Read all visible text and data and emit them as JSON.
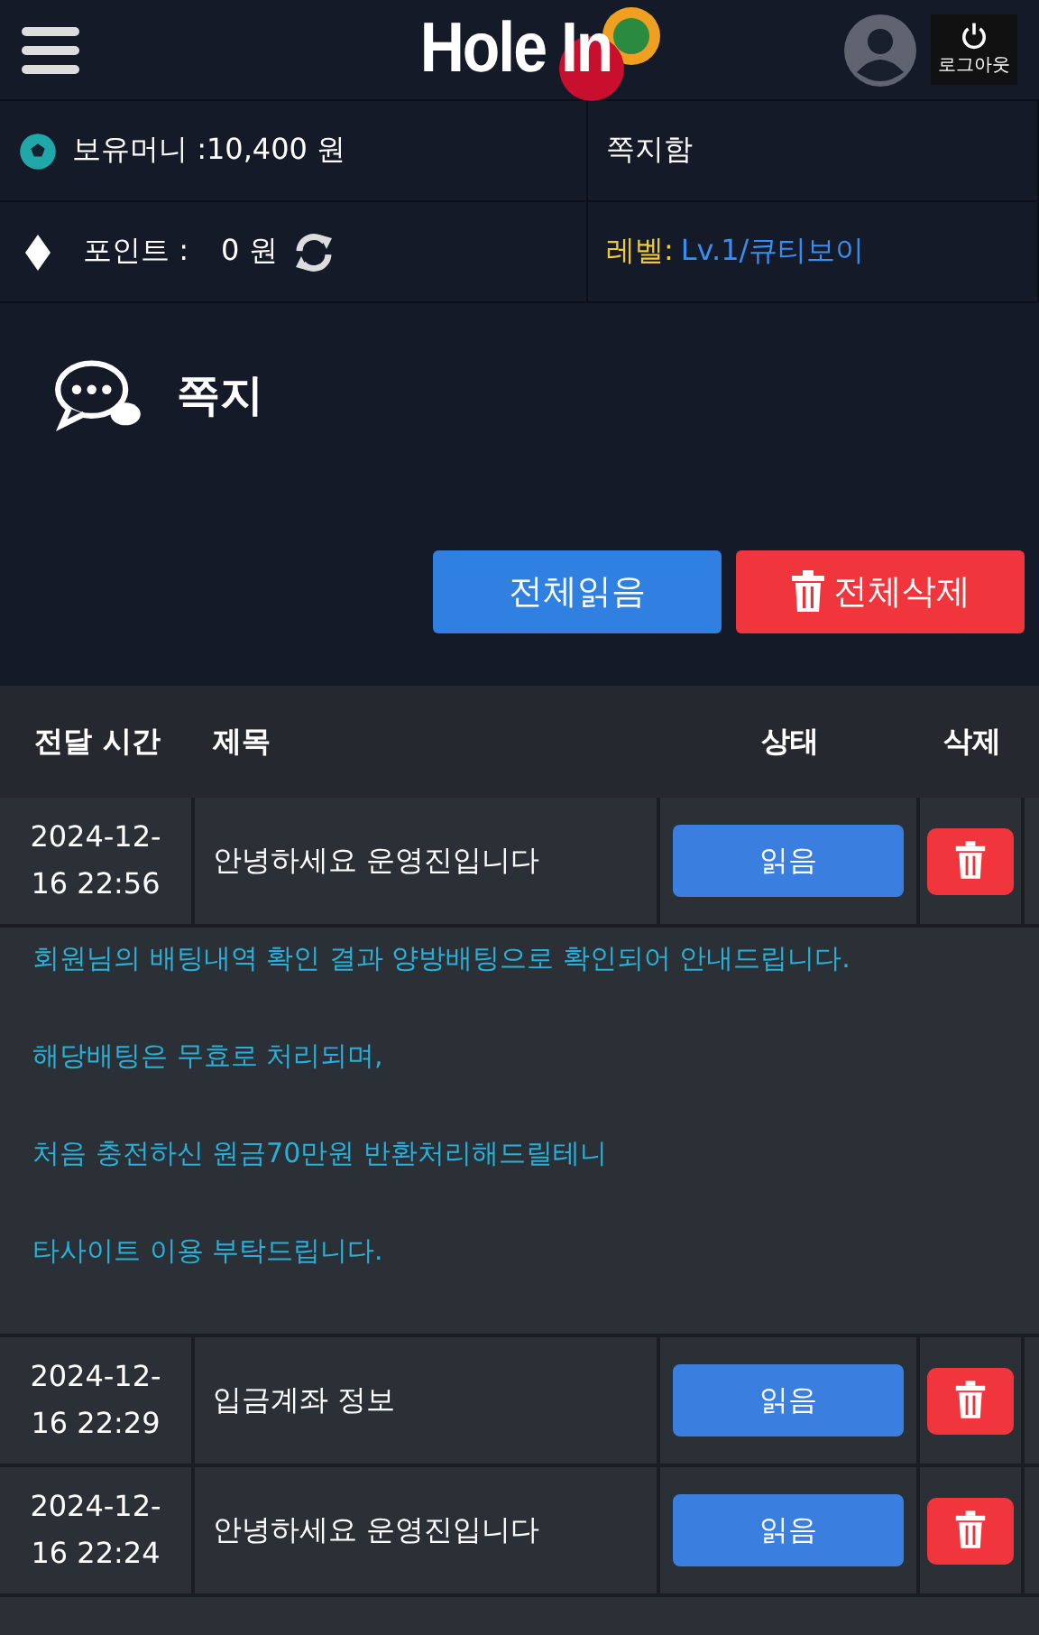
{
  "header": {
    "logo": "Hole In",
    "logout": "로그아웃"
  },
  "info": {
    "money_label": "보유머니 :10,400 원",
    "messages_link": "쪽지함",
    "points_label": "포인트 :",
    "points_value": "0 원",
    "level_label": "레벨:",
    "level_value": "Lv.1/큐티보이"
  },
  "page": {
    "title": "쪽지",
    "buttons": [
      {
        "kind": "read_all",
        "label": "전체읽음"
      },
      {
        "kind": "delete_all",
        "label": "전체삭제"
      }
    ]
  },
  "table": {
    "columns": [
      "전달 시간",
      "제목",
      "상태",
      "삭제"
    ],
    "rows": [
      {
        "time": "2024-12-16 22:56",
        "subject": "안녕하세요 운영진입니다",
        "status": "읽음",
        "message": [
          "회원님의 배팅내역 확인 결과 양방배팅으로 확인되어 안내드립니다.",
          "해당배팅은 무효로 처리되며,",
          "처음 충전하신 원금70만원 반환처리해드릴테니",
          "타사이트 이용 부탁드립니다."
        ]
      },
      {
        "time": "2024-12-16 22:29",
        "subject": "입금계좌 정보",
        "status": "읽음"
      },
      {
        "time": "2024-12-16 22:24",
        "subject": "안녕하세요 운영진입니다",
        "status": "읽음"
      }
    ]
  }
}
